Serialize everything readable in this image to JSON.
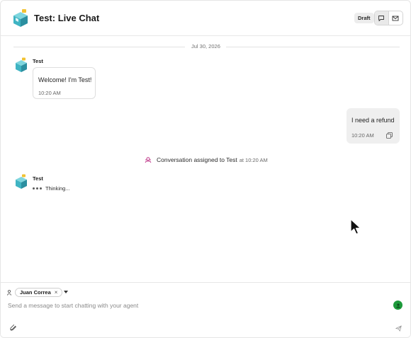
{
  "header": {
    "title": "Test: Live Chat",
    "badge": "Draft",
    "icons": [
      "chat-bubble-icon",
      "mail-icon"
    ]
  },
  "conversation": {
    "date": "Jul 30, 2026",
    "messages": [
      {
        "sender": "Test",
        "text": "Welcome! I'm Test!",
        "time": "10:20 AM",
        "direction": "incoming"
      },
      {
        "text": "I need a refund",
        "time": "10:20 AM",
        "direction": "outgoing"
      }
    ],
    "system_event": {
      "text": "Conversation assigned to Test",
      "time": "at 10:20 AM"
    },
    "typing": {
      "sender": "Test",
      "text": "Thinking..."
    }
  },
  "composer": {
    "assignee": "Juan Correa",
    "remove_glyph": "×",
    "placeholder": "Send a message to start chatting with your agent",
    "value": ""
  },
  "colors": {
    "status_green": "#1d9a3b",
    "system_pink": "#c0398a",
    "avatar_teal": "#4cc3d0"
  }
}
